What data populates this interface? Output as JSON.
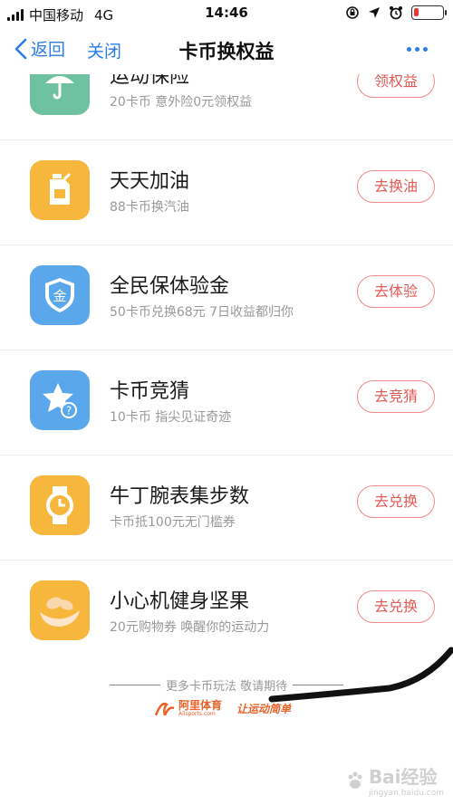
{
  "status_bar": {
    "carrier": "中国移动",
    "network": "4G",
    "time": "14:46",
    "battery_level": 0.15,
    "battery_color": "#e53935"
  },
  "nav": {
    "back_label": "返回",
    "close_label": "关闭",
    "title": "卡币换权益",
    "more_icon": "more-dots-icon",
    "accent_color": "#2b7be9"
  },
  "items": [
    {
      "icon": "umbrella-icon",
      "title": "运动保险",
      "subtitle": "20卡币 意外险0元领权益",
      "button": "领权益"
    },
    {
      "icon": "fuel-can-icon",
      "title": "天天加油",
      "subtitle": "88卡币换汽油",
      "button": "去换油"
    },
    {
      "icon": "gold-shield-icon",
      "title": "全民保体验金",
      "subtitle": "50卡币兑换68元 7日收益都归你",
      "button": "去体验"
    },
    {
      "icon": "star-question-icon",
      "title": "卡币竞猜",
      "subtitle": "10卡币 指尖见证奇迹",
      "button": "去竞猜"
    },
    {
      "icon": "watch-icon",
      "title": "牛丁腕表集步数",
      "subtitle": "卡币抵100元无门槛券",
      "button": "去兑换"
    },
    {
      "icon": "nuts-icon",
      "title": "小心机健身坚果",
      "subtitle": "20元购物券 唤醒你的运动力",
      "button": "去兑换"
    }
  ],
  "footer": {
    "more_text": "更多卡币玩法 敬请期待",
    "brand_name": "阿里体育",
    "brand_domain": "Alisports.com",
    "slogan": "让运动简单",
    "watermark_text": "Bai经验",
    "watermark_sub": "jingyan.baidu.com"
  }
}
